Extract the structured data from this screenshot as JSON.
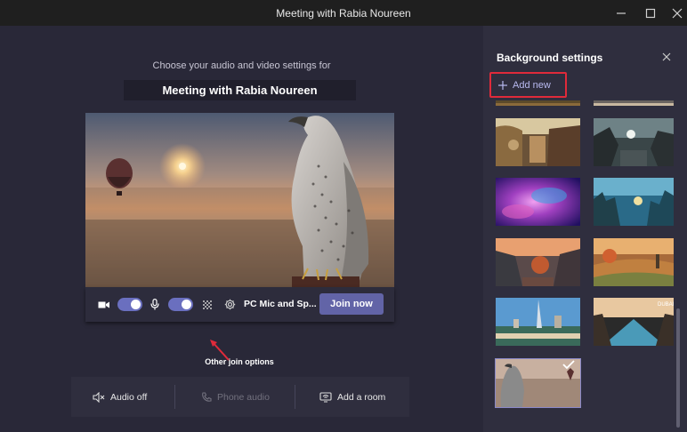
{
  "window": {
    "title": "Meeting with Rabia Noureen"
  },
  "prejoin": {
    "prompt": "Choose your audio and video settings for",
    "meeting_name": "Meeting with Rabia Noureen",
    "device_label": "PC Mic and Sp...",
    "join_label": "Join now",
    "camera_on": true,
    "mic_on": true,
    "other_options_label": "Other join options",
    "options": [
      {
        "label": "Audio off",
        "icon": "speaker-off-icon",
        "enabled": true
      },
      {
        "label": "Phone audio",
        "icon": "phone-icon",
        "enabled": false
      },
      {
        "label": "Add a room",
        "icon": "cast-room-icon",
        "enabled": true
      }
    ]
  },
  "background_settings": {
    "title": "Background settings",
    "add_new_label": "Add new",
    "thumbnails": [
      {
        "name": "mountain-landscape",
        "selected": false
      },
      {
        "name": "dark-landscape",
        "selected": false
      },
      {
        "name": "fantasy-alley",
        "selected": false
      },
      {
        "name": "scifi-canyon",
        "selected": false
      },
      {
        "name": "purple-galaxy",
        "selected": false
      },
      {
        "name": "blue-city",
        "selected": false
      },
      {
        "name": "autumn-village",
        "selected": false
      },
      {
        "name": "orange-fields",
        "selected": false
      },
      {
        "name": "dubai-skyline",
        "selected": false
      },
      {
        "name": "infinity-pool",
        "selected": false
      },
      {
        "name": "falcon-desert",
        "selected": true
      }
    ]
  },
  "colors": {
    "accent": "#6264a7",
    "highlight": "#e02a3a",
    "main_bg": "#292838",
    "panel_bg": "#2f2e3e"
  }
}
